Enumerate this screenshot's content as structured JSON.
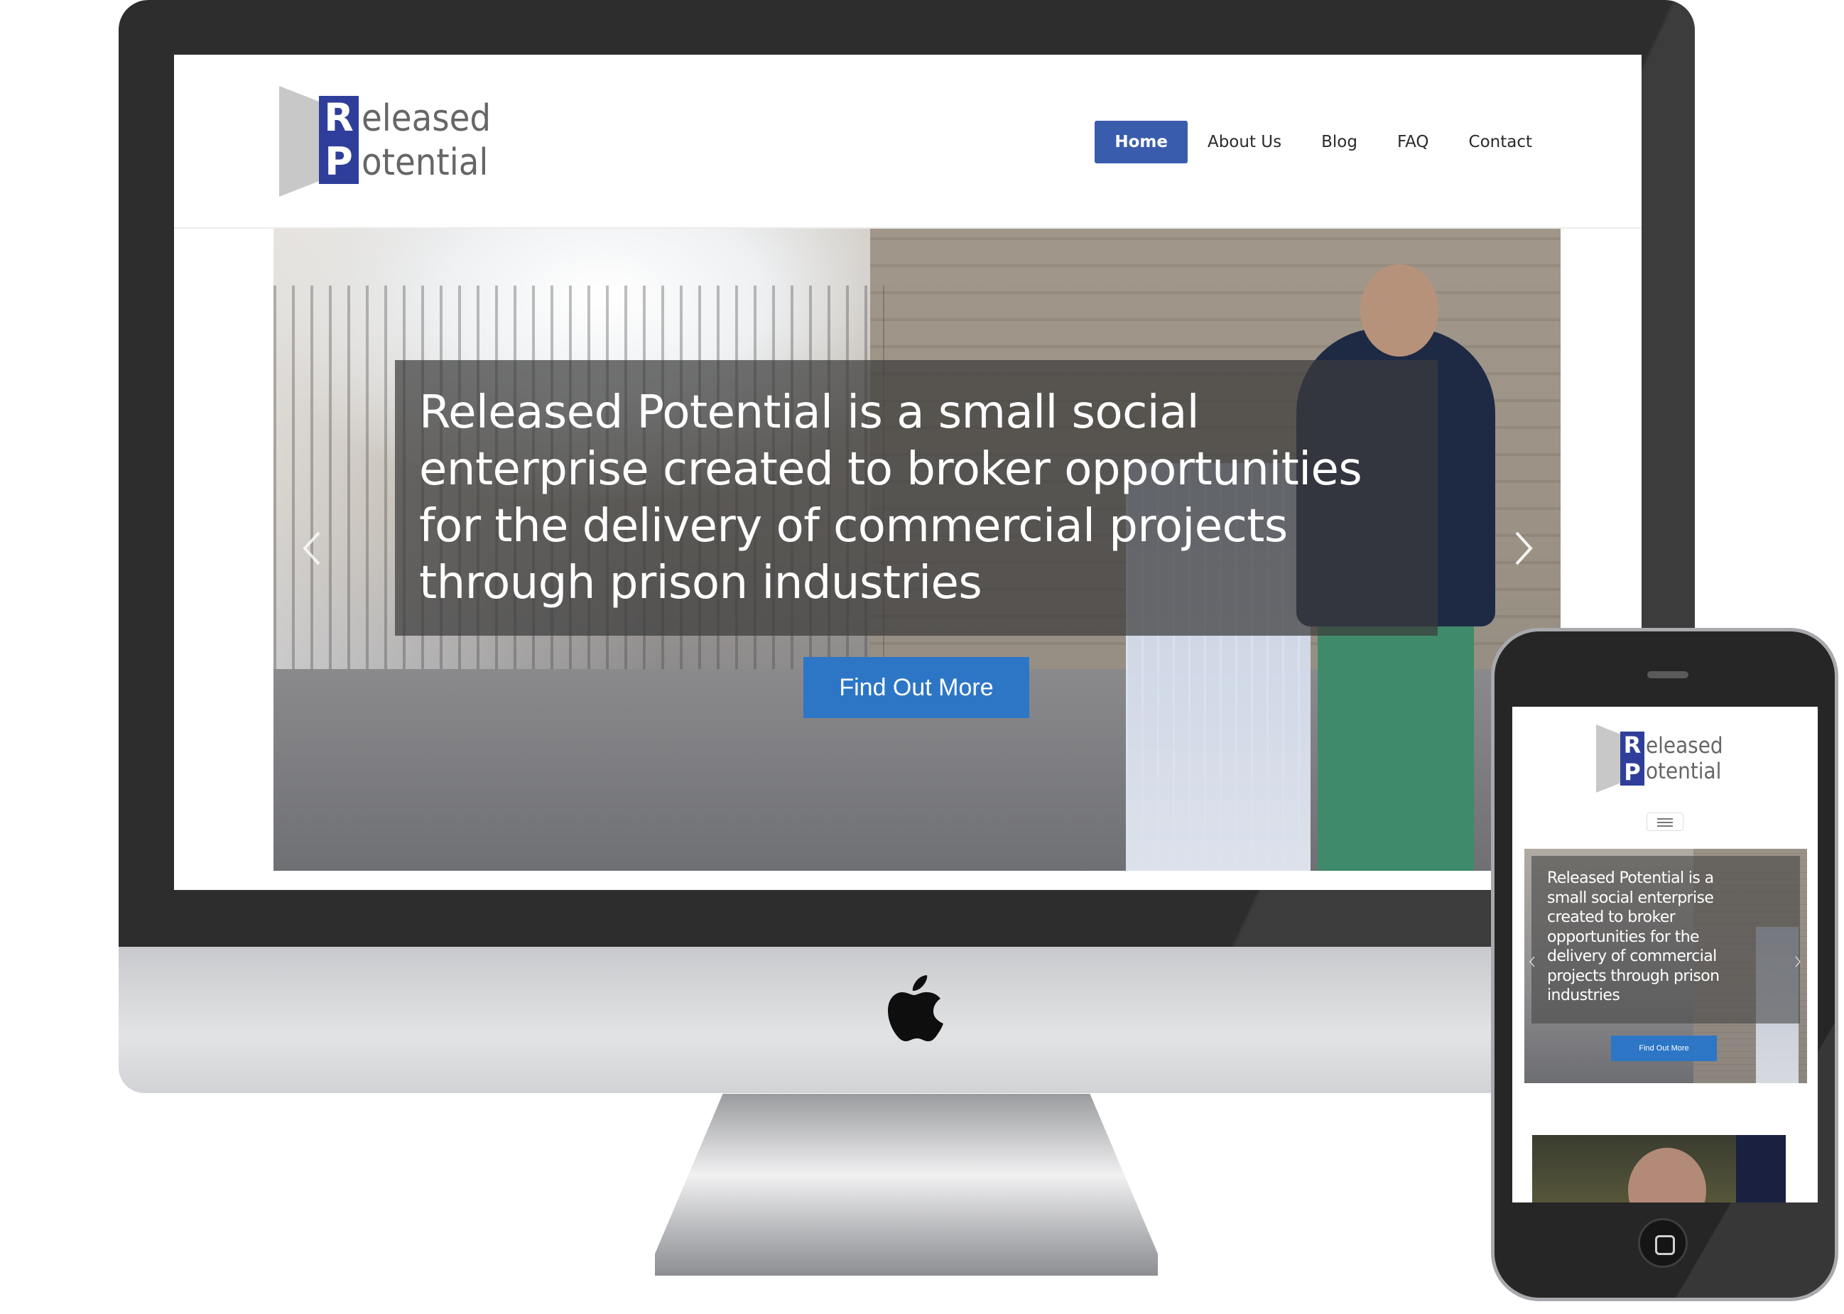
{
  "desktop": {
    "logo": {
      "letter1": "R",
      "word1": "eleased",
      "letter2": "P",
      "word2": "otential"
    },
    "nav": [
      {
        "label": "Home",
        "active": true
      },
      {
        "label": "About Us",
        "active": false
      },
      {
        "label": "Blog",
        "active": false
      },
      {
        "label": "FAQ",
        "active": false
      },
      {
        "label": "Contact",
        "active": false
      }
    ],
    "hero": {
      "caption_lines": [
        "Released Potential is a small social",
        "enterprise created to broker opportunities",
        "for the delivery of commercial projects",
        "through prison industries"
      ],
      "cta_label": "Find Out More"
    }
  },
  "mobile": {
    "logo": {
      "letter1": "R",
      "word1": "eleased",
      "letter2": "P",
      "word2": "otential"
    },
    "hero": {
      "caption_lines": [
        "Released Potential is a",
        "small social enterprise",
        "created to broker",
        "opportunities for the",
        "delivery of commercial",
        "projects through prison",
        "industries"
      ],
      "cta_label": "Find Out More"
    }
  },
  "colors": {
    "primary_blue": "#3a5cad",
    "cta_blue": "#2d76c6",
    "logo_blue": "#2e3e9a",
    "logo_grey": "#666666",
    "bezel": "#2d2d2d"
  },
  "icons": [
    "apple-logo-icon",
    "chevron-left-icon",
    "chevron-right-icon",
    "hamburger-menu-icon",
    "home-button-icon"
  ]
}
